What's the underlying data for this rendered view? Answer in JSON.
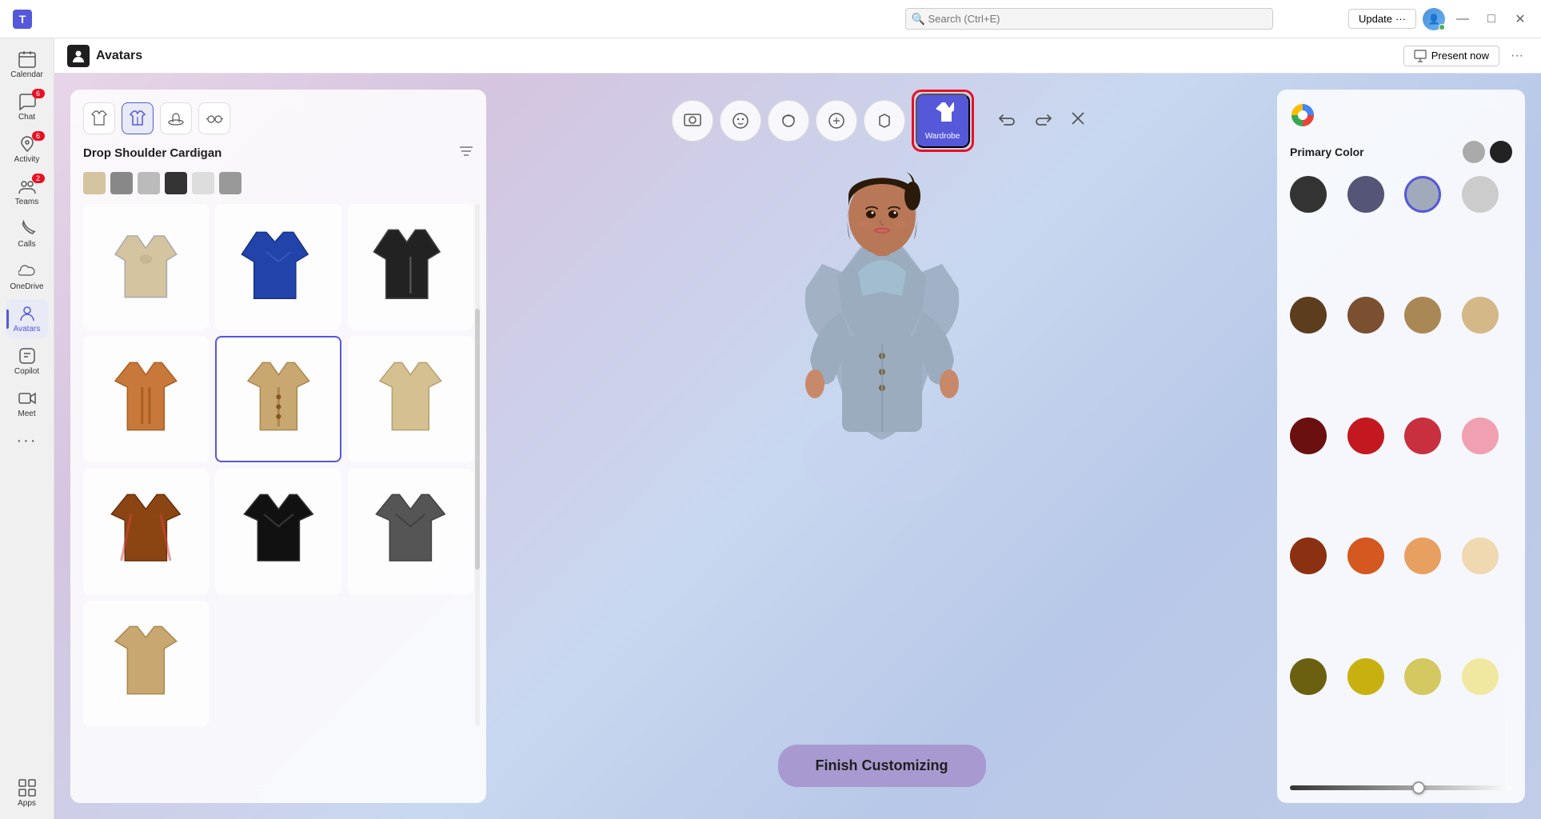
{
  "titlebar": {
    "search_placeholder": "Search (Ctrl+E)",
    "update_label": "Update",
    "update_ellipsis": "···",
    "minimize": "—",
    "maximize": "□",
    "close": "✕"
  },
  "sidebar": {
    "items": [
      {
        "id": "calendar",
        "label": "Calendar",
        "icon": "📅",
        "badge": null
      },
      {
        "id": "chat",
        "label": "Chat",
        "icon": "💬",
        "badge": "6"
      },
      {
        "id": "activity",
        "label": "Activity",
        "icon": "🔔",
        "badge": "6"
      },
      {
        "id": "teams",
        "label": "Teams",
        "icon": "👥",
        "badge": "2"
      },
      {
        "id": "calls",
        "label": "Calls",
        "icon": "📞",
        "badge": null
      },
      {
        "id": "onedrive",
        "label": "OneDrive",
        "icon": "☁",
        "badge": null
      },
      {
        "id": "avatars",
        "label": "Avatars",
        "icon": "🧑",
        "badge": null,
        "active": true
      },
      {
        "id": "copilot",
        "label": "Copilot",
        "icon": "🤖",
        "badge": null
      },
      {
        "id": "meet",
        "label": "Meet",
        "icon": "🎥",
        "badge": null
      },
      {
        "id": "more",
        "label": "···",
        "icon": "···",
        "badge": null
      },
      {
        "id": "apps",
        "label": "Apps",
        "icon": "⊞",
        "badge": null
      }
    ]
  },
  "app_header": {
    "title": "Avatars",
    "present_now": "Present now",
    "more": "···"
  },
  "toolbar": {
    "buttons": [
      {
        "id": "avatar-select",
        "icon": "🖼",
        "label": ""
      },
      {
        "id": "face",
        "icon": "😊",
        "label": ""
      },
      {
        "id": "hair",
        "icon": "👤",
        "label": ""
      },
      {
        "id": "features",
        "icon": "⚙",
        "label": ""
      },
      {
        "id": "accessories",
        "icon": "🎒",
        "label": ""
      }
    ],
    "wardrobe": {
      "label": "Wardrobe"
    },
    "undo": "↺",
    "redo": "↻",
    "close": "✕"
  },
  "left_panel": {
    "tabs": [
      {
        "id": "tops",
        "icon": "👕"
      },
      {
        "id": "jackets",
        "icon": "🧥",
        "active": true
      },
      {
        "id": "hats",
        "icon": "🎩"
      },
      {
        "id": "glasses",
        "icon": "👓"
      }
    ],
    "title": "Drop Shoulder Cardigan",
    "color_swatches": [
      "#d4c4a0",
      "#888888",
      "#aaaaaa",
      "#444444",
      "#cccccc",
      "#999999"
    ],
    "clothing_items": [
      {
        "id": 1,
        "color": "#d4c4a0",
        "type": "hoodie"
      },
      {
        "id": 2,
        "color": "#2244aa",
        "type": "jacket"
      },
      {
        "id": 3,
        "color": "#222222",
        "type": "military"
      },
      {
        "id": 4,
        "color": "#d4a868",
        "type": "cardigan-open"
      },
      {
        "id": 5,
        "color": "#c8a870",
        "type": "cardigan",
        "selected": true
      },
      {
        "id": 6,
        "color": "#c8b888",
        "type": "cardigan-beige"
      },
      {
        "id": 7,
        "color": "#8B4513",
        "type": "plaid"
      },
      {
        "id": 8,
        "color": "#111111",
        "type": "blazer-black"
      },
      {
        "id": 9,
        "color": "#555555",
        "type": "blazer-gray"
      },
      {
        "id": 10,
        "color": "#c8a870",
        "type": "coat"
      }
    ]
  },
  "right_panel": {
    "primary_color_label": "Primary Color",
    "primary_swatches": [
      "#aaaaaa",
      "#222222"
    ],
    "colors": [
      "#333333",
      "#555577",
      "#a0aabb",
      "#cccccc",
      "#5c3d1e",
      "#7a5030",
      "#aa8855",
      "#d4b888",
      "#6b1010",
      "#c41820",
      "#c83040",
      "#f0a0b0",
      "#8B3010",
      "#d45820",
      "#e8a060",
      "#f0d8b0",
      "#6b6010",
      "#c8b010",
      "#d4c860",
      "#f0e8a0"
    ],
    "selected_color_index": 2,
    "brightness_value": 55
  },
  "finish_btn": "Finish Customizing"
}
